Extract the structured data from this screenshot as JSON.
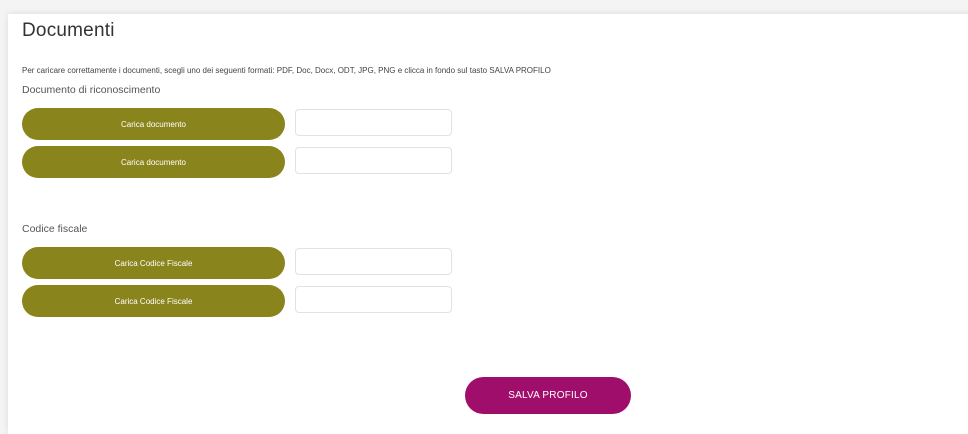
{
  "page": {
    "title": "Documenti",
    "intro": "Per caricare correttamente i documenti, scegli uno dei seguenti formati: PDF, Doc, Docx, ODT, JPG, PNG e clicca in fondo sul tasto SALVA PROFILO"
  },
  "sections": {
    "id_document": {
      "label": "Documento di riconoscimento",
      "uploads": [
        {
          "button_label": "Carica documento",
          "file_value": ""
        },
        {
          "button_label": "Carica documento",
          "file_value": ""
        }
      ]
    },
    "tax_code": {
      "label": "Codice fiscale",
      "uploads": [
        {
          "button_label": "Carica Codice Fiscale",
          "file_value": ""
        },
        {
          "button_label": "Carica Codice Fiscale",
          "file_value": ""
        }
      ]
    }
  },
  "actions": {
    "save_label": "SALVA PROFILO"
  },
  "colors": {
    "upload_button": "#8a841c",
    "save_button": "#a00e6b"
  }
}
